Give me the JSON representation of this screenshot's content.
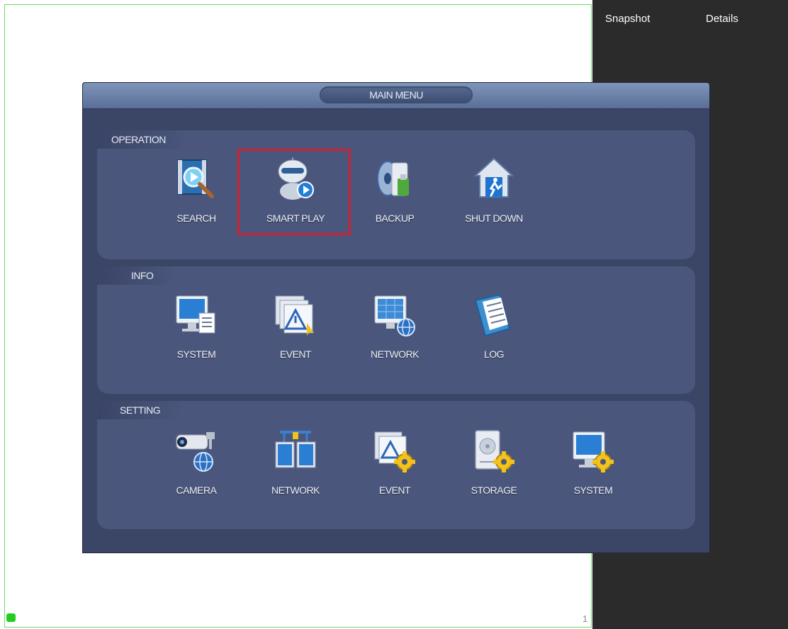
{
  "side_panel": {
    "tabs": [
      "Snapshot",
      "Details"
    ]
  },
  "corner_number": "1",
  "menu": {
    "title": "MAIN MENU",
    "sections": [
      {
        "name": "OPERATION",
        "items": [
          "SEARCH",
          "SMART PLAY",
          "BACKUP",
          "SHUT DOWN"
        ]
      },
      {
        "name": "INFO",
        "items": [
          "SYSTEM",
          "EVENT",
          "NETWORK",
          "LOG"
        ]
      },
      {
        "name": "SETTING",
        "items": [
          "CAMERA",
          "NETWORK",
          "EVENT",
          "STORAGE",
          "SYSTEM"
        ]
      }
    ],
    "highlighted_item": "SMART PLAY"
  },
  "icons": {
    "operation": [
      "film-search-icon",
      "robot-play-icon",
      "disc-usb-icon",
      "house-exit-icon"
    ],
    "info": [
      "monitor-document-icon",
      "warning-window-icon",
      "monitor-globe-icon",
      "log-book-icon"
    ],
    "setting": [
      "camera-globe-icon",
      "network-screens-icon",
      "warning-gear-icon",
      "disk-gear-icon",
      "monitor-gear-icon"
    ]
  },
  "colors": {
    "highlight": "#d02030",
    "status_green": "#22cc22"
  }
}
